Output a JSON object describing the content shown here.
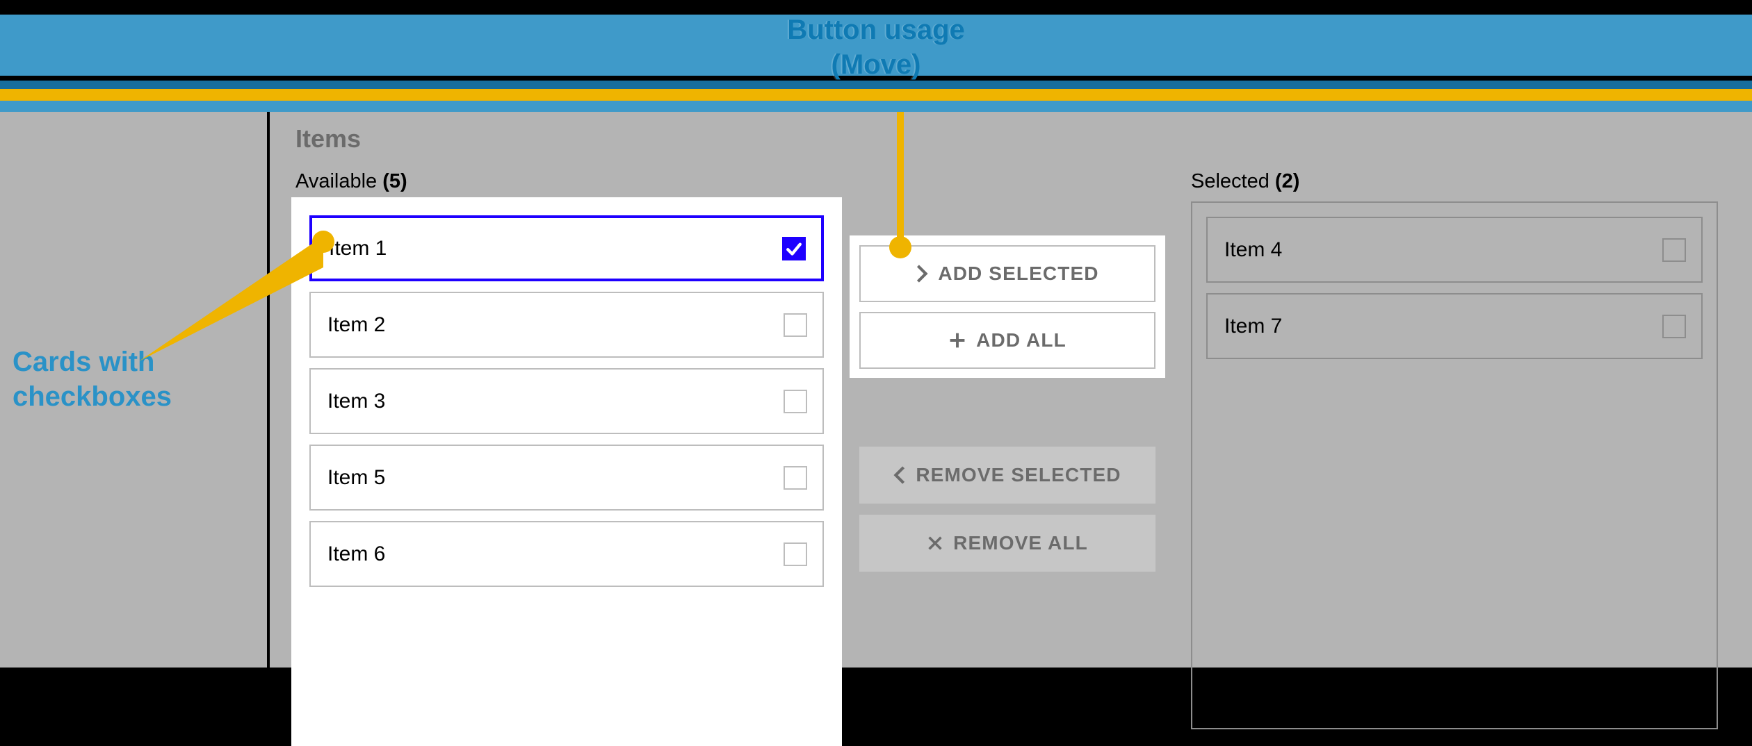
{
  "annotations": {
    "top": "Button usage\n(Move)",
    "left": "Cards with\ncheckboxes"
  },
  "section_title": "Items",
  "available": {
    "label": "Available",
    "count": "(5)",
    "items": [
      {
        "label": "Item 1",
        "checked": true,
        "focused": true
      },
      {
        "label": "Item 2",
        "checked": false,
        "focused": false
      },
      {
        "label": "Item 3",
        "checked": false,
        "focused": false
      },
      {
        "label": "Item 5",
        "checked": false,
        "focused": false
      },
      {
        "label": "Item 6",
        "checked": false,
        "focused": false
      }
    ]
  },
  "selected": {
    "label": "Selected",
    "count": "(2)",
    "items": [
      {
        "label": "Item 4",
        "checked": false
      },
      {
        "label": "Item 7",
        "checked": false
      }
    ]
  },
  "buttons": {
    "add_selected": "ADD SELECTED",
    "add_all": "ADD ALL",
    "remove_selected": "REMOVE SELECTED",
    "remove_all": "REMOVE ALL"
  }
}
